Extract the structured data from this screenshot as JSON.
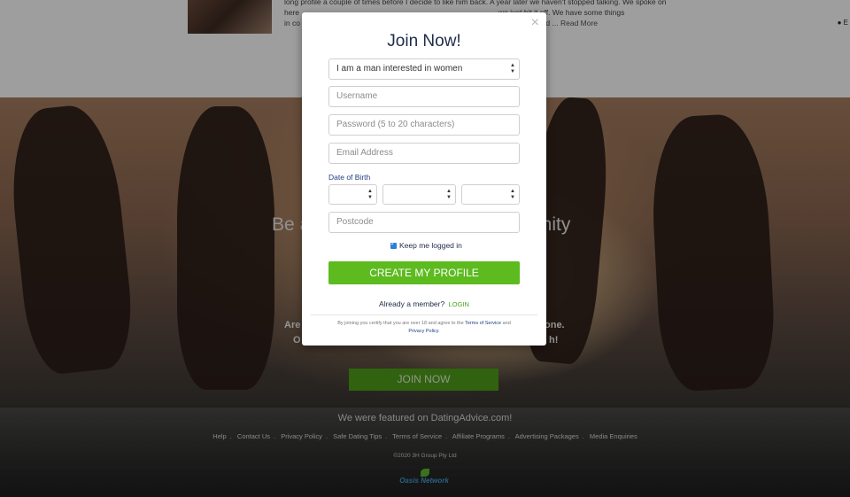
{
  "top_review": {
    "line1": "long profile a couple of times before I decide to like him back. A year later we haven't stopped talking. We spoke on",
    "line2": "here",
    "line2_right": "we just hit it off. We have some things",
    "line3": "in co",
    "line3_right": "and ...",
    "read_more": "Read More",
    "edge_text": "E"
  },
  "hero": {
    "tagline_left": "Be a",
    "tagline_right": "unity",
    "line1_left": "Are",
    "line1_right": "one.",
    "line2_left": "O",
    "line2_right": "h!",
    "join_now": "JOIN NOW",
    "featured": "We were featured on DatingAdvice.com!",
    "footer_links": [
      "Help",
      "Contact Us",
      "Privacy Policy",
      "Safe Dating Tips",
      "Terms of Service",
      "Affiliate Programs",
      "Advertising Packages",
      "Media Enquiries"
    ],
    "copyright": "©2020 3H Group Pty Ltd",
    "logo_text": "Oasis Network"
  },
  "modal": {
    "close": "×",
    "title": "Join Now!",
    "seeking_select": "I am a man interested in women",
    "username_placeholder": "Username",
    "password_placeholder": "Password (5 to 20 characters)",
    "email_placeholder": "Email Address",
    "dob_label": "Date of Birth",
    "postcode_placeholder": "Postcode",
    "keep_logged_in": "Keep me logged in",
    "create_button": "CREATE MY PROFILE",
    "already_member": "Already a member?",
    "login_link": "LOGIN",
    "terms_prefix": "By joining you certify that you are over 18 and agree to the",
    "terms_link": "Terms of Service",
    "terms_and": "and",
    "privacy_link": "Privacy Policy",
    "terms_suffix": "."
  },
  "colors": {
    "create_button": "#5dbb1f",
    "title": "#1f2b4a",
    "login_link": "#4ca21c",
    "join_now": "#4f9e19"
  }
}
